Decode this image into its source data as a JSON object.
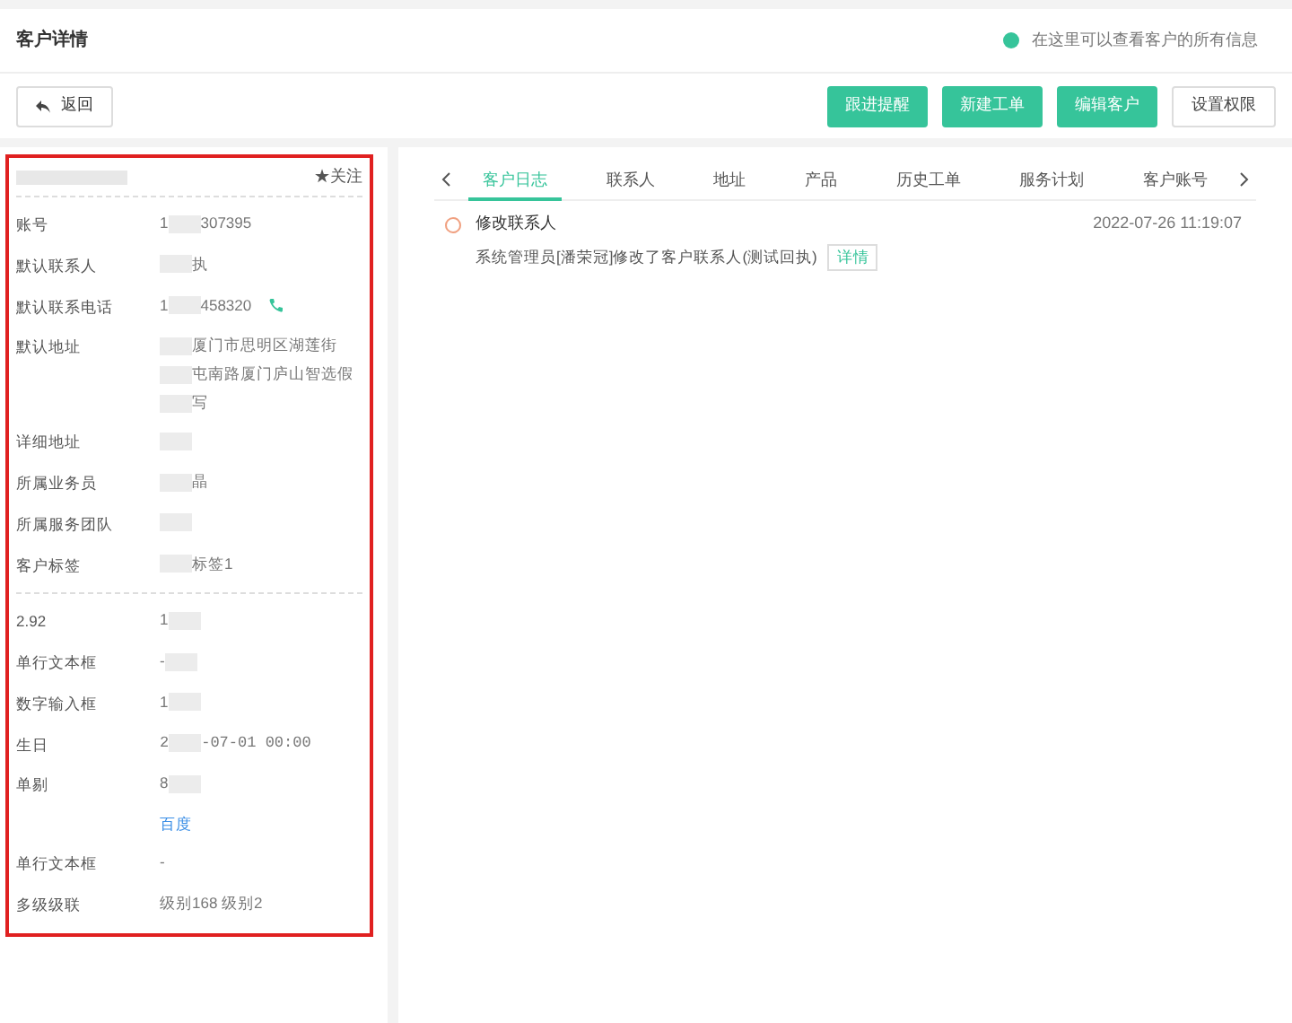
{
  "header": {
    "title": "客户详情",
    "hint": "在这里可以查看客户的所有信息"
  },
  "toolbar": {
    "back": "返回",
    "buttons": [
      {
        "label": "跟进提醒",
        "kind": "primary"
      },
      {
        "label": "新建工单",
        "kind": "primary"
      },
      {
        "label": "编辑客户",
        "kind": "primary"
      },
      {
        "label": "设置权限",
        "kind": "plain"
      }
    ]
  },
  "customer": {
    "follow": "★关注",
    "fields": [
      {
        "label": "账号",
        "lines": [
          [
            {
              "kind": "text",
              "text": "1"
            },
            {
              "kind": "mask"
            },
            {
              "kind": "text",
              "text": "307395"
            }
          ]
        ]
      },
      {
        "label": "默认联系人",
        "lines": [
          [
            {
              "kind": "mask"
            },
            {
              "kind": "text",
              "text": "执"
            }
          ]
        ]
      },
      {
        "label": "默认联系电话",
        "phone": true,
        "lines": [
          [
            {
              "kind": "text",
              "text": "1"
            },
            {
              "kind": "mask"
            },
            {
              "kind": "text",
              "text": "458320"
            }
          ]
        ]
      },
      {
        "label": "默认地址",
        "lines": [
          [
            {
              "kind": "mask"
            },
            {
              "kind": "text",
              "text": "厦门市思明区湖莲街"
            }
          ],
          [
            {
              "kind": "mask"
            },
            {
              "kind": "text",
              "text": "屯南路厦门庐山智选假"
            }
          ],
          [
            {
              "kind": "mask"
            },
            {
              "kind": "text",
              "text": "写"
            }
          ]
        ]
      },
      {
        "label": "详细地址",
        "lines": [
          [
            {
              "kind": "mask"
            }
          ]
        ]
      },
      {
        "label": "所属业务员",
        "lines": [
          [
            {
              "kind": "mask"
            },
            {
              "kind": "text",
              "text": "晶"
            }
          ]
        ]
      },
      {
        "label": "所属服务团队",
        "lines": [
          [
            {
              "kind": "mask"
            }
          ]
        ]
      },
      {
        "label": "客户标签",
        "lines": [
          [
            {
              "kind": "mask"
            },
            {
              "kind": "text",
              "text": "标签1"
            }
          ]
        ]
      },
      {
        "label": "2.92",
        "divider": true,
        "lines": [
          [
            {
              "kind": "text",
              "text": "1"
            },
            {
              "kind": "mask"
            }
          ]
        ]
      },
      {
        "label": "单行文本框",
        "lines": [
          [
            {
              "kind": "text",
              "text": "-"
            },
            {
              "kind": "mask"
            }
          ]
        ]
      },
      {
        "label": "数字输入框",
        "lines": [
          [
            {
              "kind": "text",
              "text": "1"
            },
            {
              "kind": "mask"
            }
          ]
        ]
      },
      {
        "label": "生日",
        "lines": [
          [
            {
              "kind": "mono",
              "text": "2"
            },
            {
              "kind": "mask"
            },
            {
              "kind": "mono",
              "text": "-07-01 00:00"
            }
          ]
        ]
      },
      {
        "label": "单剔",
        "lines": [
          [
            {
              "kind": "text",
              "text": "8"
            },
            {
              "kind": "mask"
            }
          ]
        ]
      },
      {
        "lines": [
          [
            {
              "kind": "link",
              "text": "百度"
            }
          ]
        ]
      },
      {
        "label": "单行文本框",
        "lines": [
          [
            {
              "kind": "text",
              "text": "-"
            }
          ]
        ]
      },
      {
        "label": "多级级联",
        "lines": [
          [
            {
              "kind": "text",
              "text": "级别168 级别2"
            }
          ]
        ]
      }
    ]
  },
  "tabs": [
    {
      "label": "客户日志",
      "selected": true
    },
    {
      "label": "联系人",
      "selected": false
    },
    {
      "label": "地址",
      "selected": false
    },
    {
      "label": "产品",
      "selected": false
    },
    {
      "label": "历史工单",
      "selected": false
    },
    {
      "label": "服务计划",
      "selected": false
    },
    {
      "label": "客户账号",
      "selected": false
    }
  ],
  "log": [
    {
      "title": "修改联系人",
      "time": "2022-07-26 11:19:07",
      "text": "系统管理员[潘荣冠]修改了客户联系人(测试回执)",
      "action": "详情"
    }
  ]
}
